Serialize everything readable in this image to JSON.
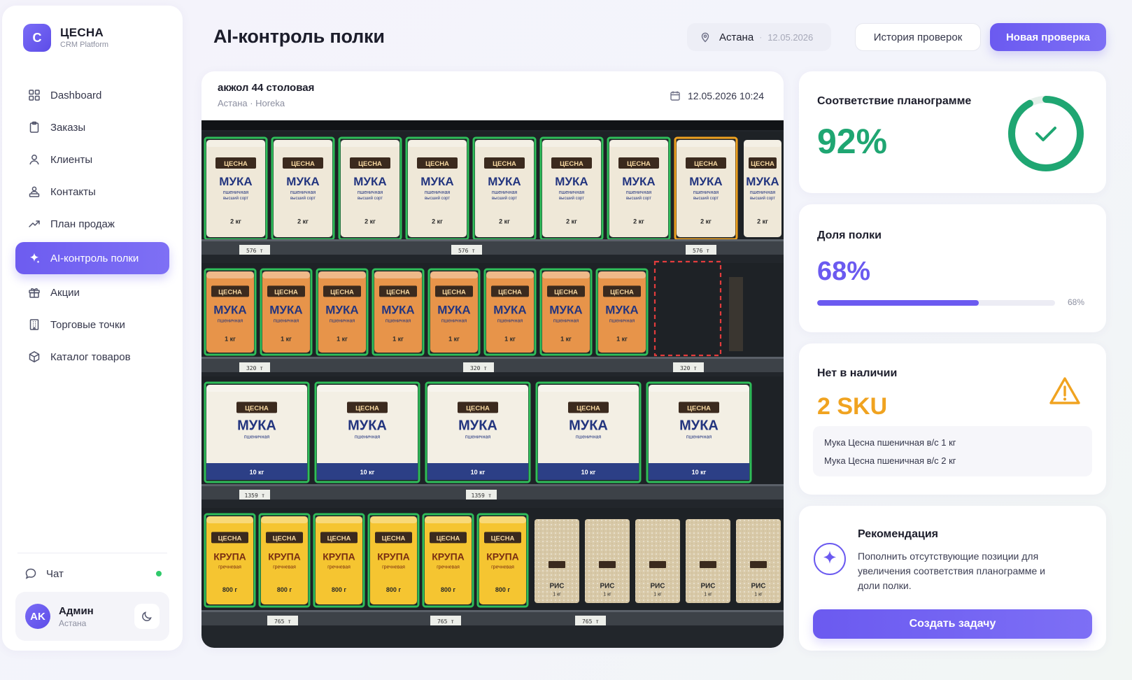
{
  "brand": {
    "logo_letter": "C",
    "name": "ЦЕСНА",
    "subtitle": "CRM Platform"
  },
  "sidebar": {
    "items": [
      {
        "label": "Dashboard",
        "icon": "grid-icon"
      },
      {
        "label": "Заказы",
        "icon": "clipboard-icon"
      },
      {
        "label": "Клиенты",
        "icon": "user-icon"
      },
      {
        "label": "Контакты",
        "icon": "contacts-icon"
      },
      {
        "label": "План продаж",
        "icon": "trend-icon"
      },
      {
        "label": "AI-контроль полки",
        "icon": "sparkle-icon",
        "active": true
      },
      {
        "label": "Акции",
        "icon": "gift-icon"
      },
      {
        "label": "Торговые точки",
        "icon": "building-icon"
      },
      {
        "label": "Каталог товаров",
        "icon": "box-icon"
      }
    ],
    "chat": {
      "label": "Чат",
      "online": true
    },
    "user": {
      "initials": "AK",
      "name": "Админ",
      "location": "Астана"
    }
  },
  "header": {
    "title": "AI-контроль полки",
    "city": "Астана",
    "separator": "·",
    "date": "12.05.2026",
    "history_button": "История проверок",
    "new_button": "Новая проверка"
  },
  "store": {
    "name": "акжол 44 столовая",
    "subtitle": "Астана · Horeka",
    "datetime": "12.05.2026 10:24"
  },
  "shelf": {
    "brand_label": "ЦЕСНА",
    "rows": [
      {
        "product": "МУКА",
        "sub": "пшеничная",
        "grade": "высший сорт",
        "weight": "2 кг",
        "price": "576 т",
        "pack_color": "#efe8d8",
        "count": 8
      },
      {
        "product": "МУКА",
        "sub": "пшеничная",
        "grade": "",
        "weight": "1 кг",
        "price": "320 т",
        "pack_color": "#e7944a",
        "count": 8
      },
      {
        "product": "МУКА",
        "sub": "пшеничная",
        "grade": "",
        "weight": "10 кг",
        "price": "1359 т",
        "pack_color": "#f3efe4",
        "count": 5
      },
      {
        "product": "КРУПА",
        "sub": "гречневая",
        "grade": "",
        "weight": "800 г",
        "price": "765 т",
        "pack_color": "#f5c531",
        "count": 6,
        "extra_product": "РИС",
        "extra_weight": "1 кг",
        "extra_count": 5
      }
    ],
    "legend_colors": {
      "ok": "#2fbe5a",
      "warning": "#f0a320",
      "missing": "#e23c3c"
    }
  },
  "planogram": {
    "title": "Соответствие планограмме",
    "value": "92%",
    "percent": 92,
    "color": "#1fa672"
  },
  "share": {
    "title": "Доля полки",
    "value": "68%",
    "percent": 68,
    "bar_label": "68%",
    "color": "#6b5af0"
  },
  "out_of_stock": {
    "title": "Нет в наличии",
    "value": "2 SKU",
    "color": "#f0a320",
    "items": [
      "Мука Цесна пшеничная в/с 1 кг",
      "Мука Цесна пшеничная в/с 2 кг"
    ]
  },
  "recommendation": {
    "title": "Рекомендация",
    "text": "Пополнить отсутствующие позиции для увеличения соответствия планограмме и доли полки.",
    "button": "Создать задачу"
  }
}
